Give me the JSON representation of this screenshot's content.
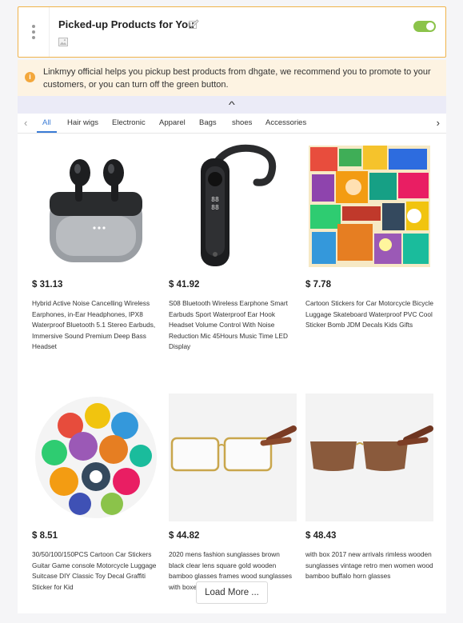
{
  "section": {
    "title": "Picked-up Products for You",
    "enabled": true,
    "colors": {
      "border": "#f0b34a",
      "toggle": "#8bc34a"
    }
  },
  "notice": {
    "text": "Linkmyy official helps you pickup best products from dhgate, we recommend you to promote to your customers, or you can turn off the green button."
  },
  "tabs": [
    "All",
    "Hair wigs",
    "Electronic",
    "Apparel",
    "Bags",
    "shoes",
    "Accessories"
  ],
  "active_tab": "All",
  "products": [
    {
      "price": "$ 31.13",
      "name": "Hybrid Active Noise Cancelling Wireless Earphones, in-Ear Headphones, IPX8 Waterproof Bluetooth 5.1 Stereo Earbuds, Immersive Sound Premium Deep Bass Headset",
      "image": "earbuds"
    },
    {
      "price": "$ 41.92",
      "name": "S08 Bluetooth Wireless Earphone Smart Earbuds Sport Waterproof Ear Hook Headset Volume Control With Noise Reduction Mic 45Hours Music Time LED Display",
      "image": "ear-hook-headset"
    },
    {
      "price": "$ 7.78",
      "name": "Cartoon Stickers for Car Motorcycle Bicycle Luggage Skateboard Waterproof PVC Cool Sticker Bomb JDM Decals Kids Gifts",
      "image": "sticker-square"
    },
    {
      "price": "$ 8.51",
      "name": "30/50/100/150PCS Cartoon Car Stickers Guitar Game console Motorcycle Luggage Suitcase DIY Classic Toy Decal Graffiti Sticker for Kid",
      "image": "sticker-circle"
    },
    {
      "price": "$ 44.82",
      "name": "2020 mens fashion sunglasses brown black clear lens square gold wooden bamboo glasses frames wood sunglasses with boxes lunettes gafas",
      "image": "clear-glasses"
    },
    {
      "price": "$ 48.43",
      "name": "with box 2017 new arrivals rimless wooden sunglasses vintage retro men women wood bamboo buffalo horn glasses",
      "image": "brown-sunglasses"
    }
  ],
  "load_more_label": "Load More ..."
}
